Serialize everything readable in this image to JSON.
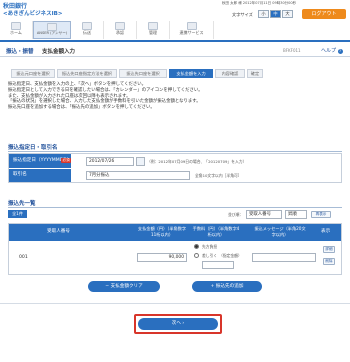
{
  "header": {
    "bank_name": "秋田銀行",
    "service_name": "<あきぎんビジネスIB>",
    "user_line": "秋田  太郎 様 2012年07月11日 09時30分00秒",
    "font_size_label": "文字サイズ",
    "font_small": "小",
    "font_medium": "中",
    "font_large": "大",
    "logout_label": "ログアウト",
    "nav": [
      {
        "label": "ホーム"
      },
      {
        "label": "ANSER (アンサー)"
      },
      {
        "label": "伝送"
      },
      {
        "label": "承認"
      },
      {
        "label": "管理"
      },
      {
        "label": "連携サービス"
      }
    ]
  },
  "page_title": {
    "category": "振込・振替",
    "title": "支払金額入力",
    "screen_code": "BFKF011",
    "help": "ヘルプ"
  },
  "steps": [
    "振込元口座を選択",
    "振込先口座指定方法を選択",
    "振込先口座を選択",
    "支払金額を入力",
    "内容確認",
    "確定"
  ],
  "current_step": 3,
  "info_lines": [
    "振込指定日、支払金額を入力の上、「次へ」ボタンを押してください。",
    "振込指定日として入力できる日を確認したい場合は、「カレンダー」のアイコンを押してください。",
    "また、支払金額が入力された口座は次回以降も表示されます。",
    "「振込の状況」を選択した場合、入力した支払金額が手数料を引いた金額が振込金額となります。",
    "振込先口座を追加する場合は、「振込先の追加」ボタンを押してください。"
  ],
  "section1": {
    "title": "振込指定日・取引名",
    "date_label": "振込指定日（YYYYMMDD）",
    "required": "必須",
    "date_value": "2012/07/26",
    "date_note": "（例：2012年07月09日の場合、「20120709」を入力）",
    "name_label": "取引名",
    "name_value": "7月分振込",
    "name_note": "全角10文字以内［半角可］"
  },
  "section2": {
    "title": "振込先一覧",
    "all_label": "全1件",
    "sort_label": "並び順：",
    "sort_value": "受取人番号",
    "order_value": "昇順",
    "sort_button": "再表示",
    "col_no": "受取人番号",
    "col_amount": "支払金額（円）（半角数字11桁以内）",
    "col_fee": "手数料（円）（半角数字4桁以内）",
    "col_message": "振込メッセージ（半角20文字以内）",
    "col_show": "表示",
    "row": {
      "no": "001",
      "amount": "90,000",
      "fee_opt1": "先方負担",
      "fee_opt2": "差し引く",
      "fee_specify": "（指定金額）",
      "fee_value": "",
      "message": "",
      "detail_btn": "詳細",
      "delete_btn": "削除"
    },
    "clear_button": "支払金額クリア",
    "add_button": "振込先の追加"
  },
  "next_button": "次へ",
  "colors": {
    "accent": "#2a6fbf",
    "logout": "#ee8a1c",
    "required": "#d8352a",
    "next_border": "#d8352a"
  }
}
